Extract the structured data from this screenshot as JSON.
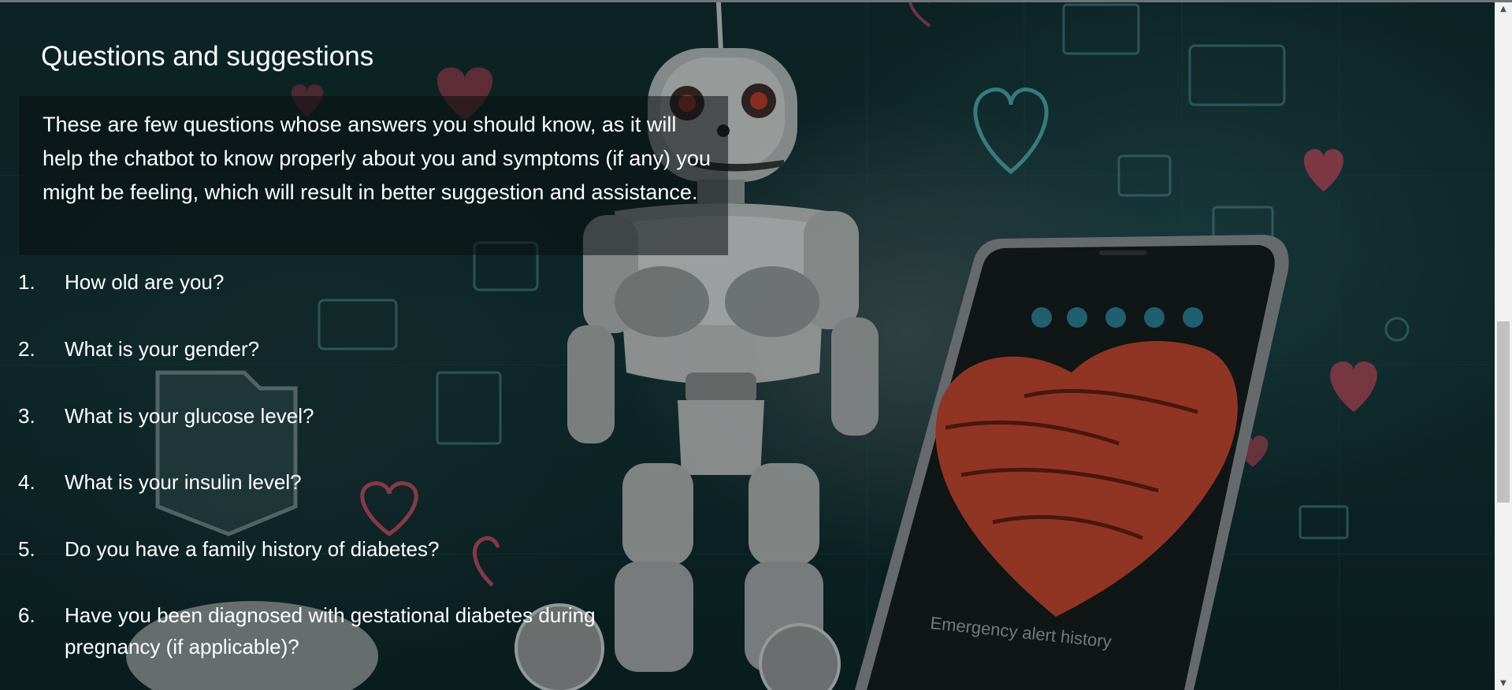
{
  "page": {
    "title": "Questions and suggestions",
    "intro": "These are few questions whose answers you should know, as it will help the chatbot to know properly about you and symptoms (if any) you might be feeling, which will result in better suggestion and assistance."
  },
  "questions": [
    {
      "number": "1.",
      "text": "How old are you?"
    },
    {
      "number": "2.",
      "text": "What is your gender?"
    },
    {
      "number": "3.",
      "text": "What is your glucose level?"
    },
    {
      "number": "4.",
      "text": "What is your insulin level?"
    },
    {
      "number": "5.",
      "text": "Do you have a family history of diabetes?"
    },
    {
      "number": "6.",
      "text": "Have you been diagnosed with gestational diabetes during pregnancy (if applicable)?"
    }
  ],
  "scrollbar": {
    "up_icon": "triangle-up-icon",
    "down_icon": "triangle-down-icon",
    "position_fraction": 0.47
  },
  "background": {
    "icon_names": [
      "robot-illustration",
      "smartphone-illustration",
      "heart-icon"
    ]
  }
}
